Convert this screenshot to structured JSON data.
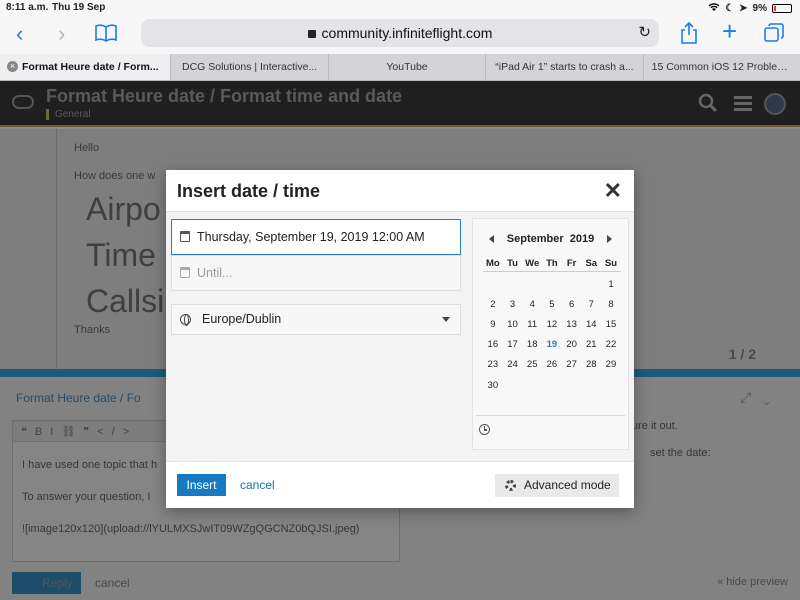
{
  "status_bar": {
    "time": "8:11 a.m.",
    "date": "Thu 19 Sep",
    "battery": "9%"
  },
  "browser": {
    "url": "community.infiniteflight.com",
    "tabs": [
      {
        "label": "Format Heure date / Form...",
        "active": true
      },
      {
        "label": "DCG Solutions | Interactive...",
        "active": false
      },
      {
        "label": "YouTube",
        "active": false
      },
      {
        "label": "“iPad Air 1” starts to crash a...",
        "active": false
      },
      {
        "label": "15 Common iOS 12 Problems...",
        "active": false
      }
    ]
  },
  "page": {
    "topic_title": "Format Heure date / Format time and date",
    "category": "General",
    "post": {
      "hello": "Hello",
      "question": "How does one w",
      "line1": "Airpo",
      "line2": "Time",
      "line3": "Callsi",
      "thanks": "Thanks"
    },
    "pager": "1 / 2",
    "composer": {
      "header": "Format Heure date / Fo",
      "body_line1": "I have used one topic that h",
      "body_line2": "To answer your question, I",
      "body_line3": "![image120x120](upload://lYULMXSJwIT09WZgQGCNZ0bQJSI.jpeg)",
      "reply_label": "Reply",
      "cancel_label": "cancel",
      "preview_line1": "ure it out.",
      "preview_line2": "set the date:",
      "hide_preview": "« hide preview"
    }
  },
  "modal": {
    "title": "Insert date / time",
    "from_value": "Thursday, September 19, 2019 12:00 AM",
    "until_placeholder": "Until...",
    "timezone": "Europe/Dublin",
    "calendar": {
      "month": "September",
      "year": "2019",
      "weekdays": [
        "Mo",
        "Tu",
        "We",
        "Th",
        "Fr",
        "Sa",
        "Su"
      ],
      "weeks": [
        [
          "",
          "",
          "",
          "",
          "",
          "",
          "1"
        ],
        [
          "2",
          "3",
          "4",
          "5",
          "6",
          "7",
          "8"
        ],
        [
          "9",
          "10",
          "11",
          "12",
          "13",
          "14",
          "15"
        ],
        [
          "16",
          "17",
          "18",
          "19",
          "20",
          "21",
          "22"
        ],
        [
          "23",
          "24",
          "25",
          "26",
          "27",
          "28",
          "29"
        ],
        [
          "30",
          "",
          "",
          "",
          "",
          "",
          ""
        ]
      ],
      "selected_day": "19"
    },
    "insert_label": "Insert",
    "cancel_label": "cancel",
    "advanced_label": "Advanced mode"
  },
  "colors": {
    "primary": "#1779c2",
    "selected_day": "#2a7fb3",
    "header_bg": "#1f1f1f"
  },
  "icons": [
    "wifi-icon",
    "moon-icon",
    "location-icon",
    "battery-icon",
    "back-icon",
    "forward-icon",
    "bookmarks-icon",
    "lock-icon",
    "reload-icon",
    "share-icon",
    "new-tab-icon",
    "tabs-icon",
    "search-icon",
    "menu-icon",
    "calendar-icon",
    "globe-icon",
    "clock-icon",
    "gear-icon",
    "close-icon"
  ]
}
